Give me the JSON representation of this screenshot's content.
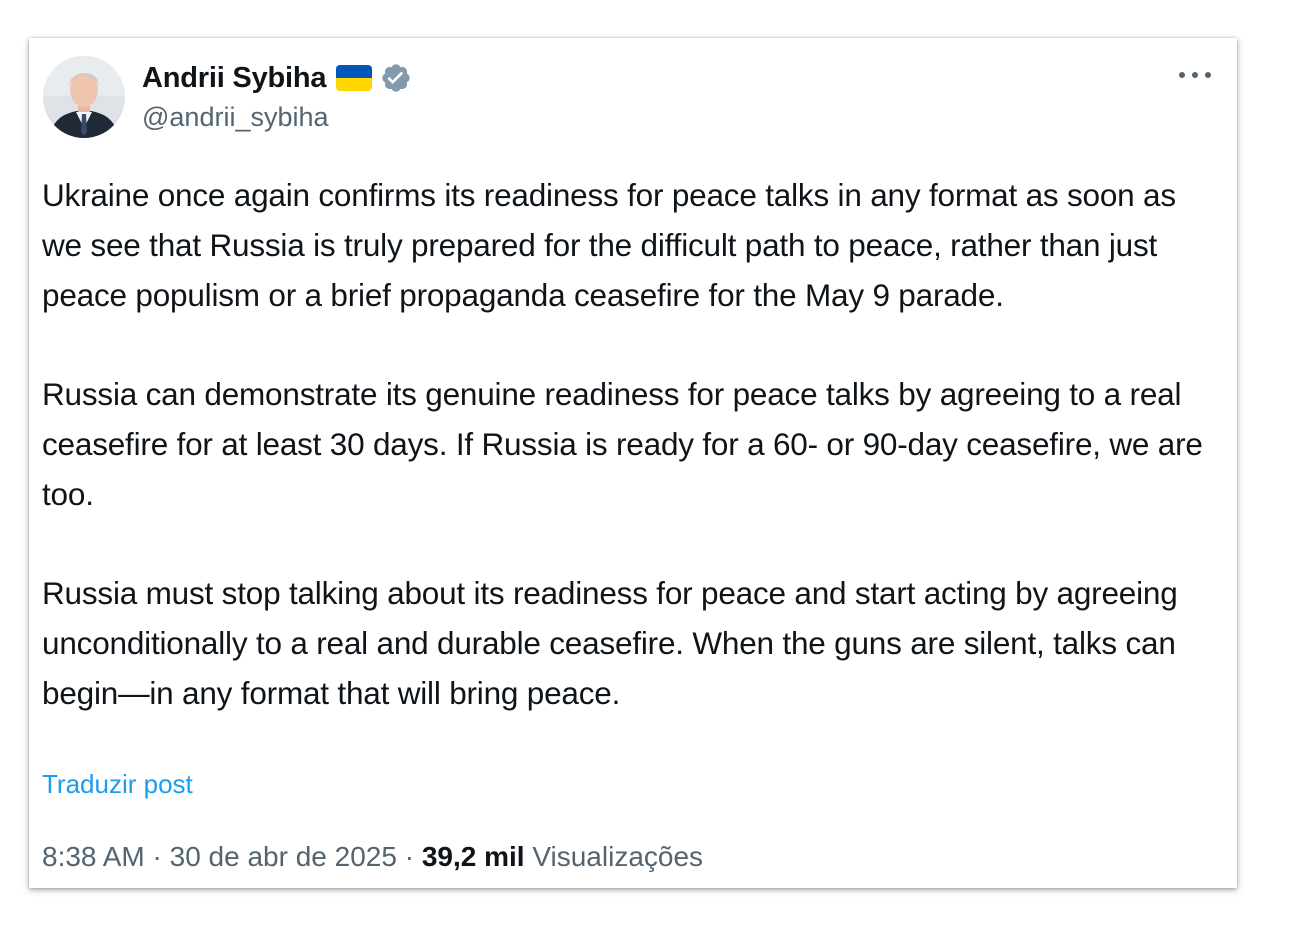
{
  "author": {
    "display_name": "Andrii Sybiha",
    "handle": "@andrii_sybiha",
    "flag_icon": "ukraine-flag-icon",
    "verified_icon": "verified-badge-icon",
    "colors": {
      "flag_blue": "#0057b7",
      "flag_yellow": "#ffd700",
      "badge_gray": "#829aab"
    }
  },
  "more_menu": {
    "icon": "more-options-icon",
    "label": "···"
  },
  "tweet": {
    "paragraphs": [
      "Ukraine once again confirms its readiness for peace talks in any format as soon as we see that Russia is truly prepared for the difficult path to peace, rather than just peace populism or a brief propaganda ceasefire for the May 9 parade.",
      "Russia can demonstrate its genuine readiness for peace talks by agreeing to a real ceasefire for at least 30 days. If Russia is ready for a 60- or 90-day ceasefire, we are too.",
      "Russia must stop talking about its readiness for peace and start acting by agreeing unconditionally to a real and durable ceasefire. When the guns are silent, talks can begin—in any format that will bring peace."
    ],
    "translate_label": "Traduzir post"
  },
  "meta": {
    "time": "8:38 AM",
    "separator": "·",
    "date": "30 de abr de 2025",
    "views_count": "39,2 mil",
    "views_label": "Visualizações"
  },
  "colors": {
    "text": "#0f1419",
    "secondary": "#536471",
    "link": "#1d9bf0"
  }
}
